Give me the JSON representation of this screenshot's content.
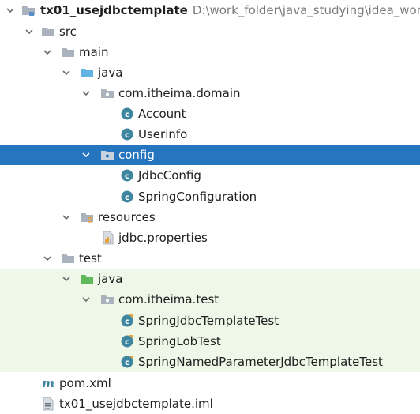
{
  "project": {
    "name": "tx01_usejdbctemplate",
    "path": "D:\\work_folder\\java_studying\\idea_worksp"
  },
  "tree": {
    "src": "src",
    "main": "main",
    "java_main": "java",
    "pkg_domain": "com.itheima.domain",
    "account": "Account",
    "userinfo": "Userinfo",
    "config": "config",
    "jdbc_config": "JdbcConfig",
    "spring_configuration": "SpringConfiguration",
    "resources": "resources",
    "jdbc_properties": "jdbc.properties",
    "test": "test",
    "java_test": "java",
    "pkg_test": "com.itheima.test",
    "test1": "SpringJdbcTemplateTest",
    "test2": "SpringLobTest",
    "test3": "SpringNamedParameterJdbcTemplateTest",
    "pom": "pom.xml",
    "iml": "tx01_usejdbctemplate.iml"
  },
  "icons": {
    "folder": "folder-icon",
    "source_folder": "source-folder-icon",
    "test_folder": "test-source-folder-icon",
    "package": "package-icon",
    "class": "class-icon",
    "test_class": "test-class-icon",
    "resources_folder": "resources-folder-icon",
    "properties_file": "properties-file-icon",
    "maven_file": "maven-pom-icon",
    "module_file": "module-file-icon"
  },
  "colors": {
    "selection": "#2675bf",
    "test_tint": "#eef7e8",
    "folder": "#a9b2bd",
    "source_folder": "#62b4e6",
    "test_folder": "#5fb85a",
    "class_icon": "#3e86a0"
  }
}
